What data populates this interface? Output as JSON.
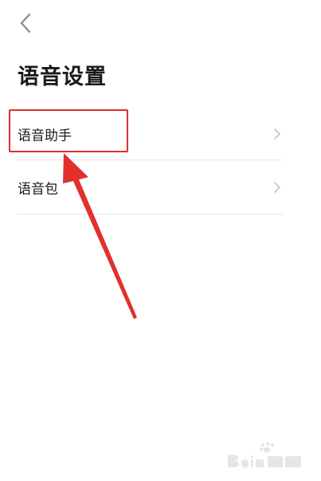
{
  "header": {
    "title": "语音设置"
  },
  "settings": {
    "items": [
      {
        "label": "语音助手"
      },
      {
        "label": "语音包"
      }
    ]
  },
  "colors": {
    "annotation_red": "#d9302c",
    "divider": "#e8e8e8",
    "text": "#1a1a1a",
    "chevron": "#c4c4c4"
  },
  "icons": {
    "back": "chevron-left-icon",
    "item_arrow": "chevron-right-icon"
  }
}
